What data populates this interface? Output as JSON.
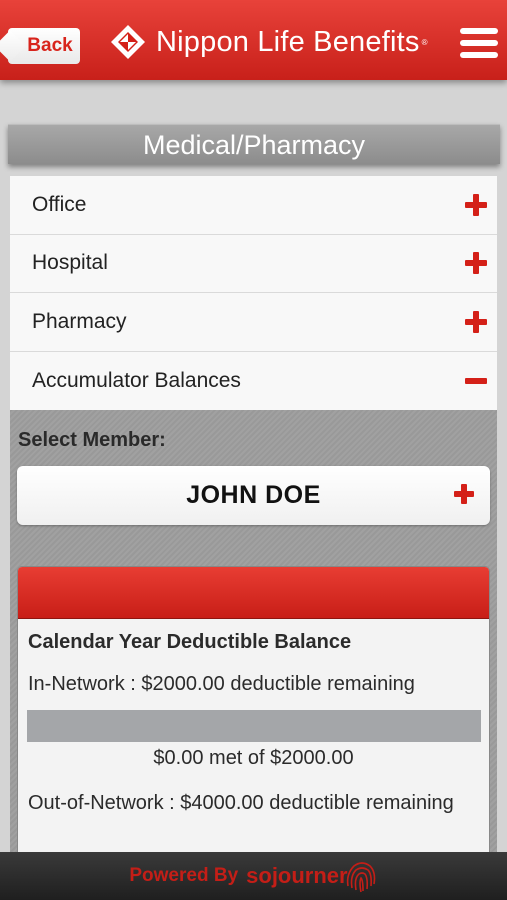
{
  "header": {
    "back_label": "Back",
    "brand_name": "Nippon Life Benefits",
    "brand_reg": "®",
    "logo_icon": "nippon-life-logo-icon",
    "menu_icon": "hamburger-menu-icon",
    "accent_color": "#d42018"
  },
  "section": {
    "title": "Medical/Pharmacy"
  },
  "accordion": {
    "items": [
      {
        "label": "Office",
        "icon": "plus-icon"
      },
      {
        "label": "Hospital",
        "icon": "plus-icon"
      },
      {
        "label": "Pharmacy",
        "icon": "plus-icon"
      },
      {
        "label": "Accumulator Balances",
        "icon": "minus-icon"
      }
    ]
  },
  "accumulator": {
    "select_label": "Select Member:",
    "member_name": "JOHN DOE",
    "card": {
      "title": "Calendar Year Deductible Balance",
      "in_network": "In-Network : $2000.00 deductible remaining",
      "progress_fraction": 0,
      "met_text": "$0.00 met of $2000.00",
      "out_network": "Out-of-Network : $4000.00 deductible remaining"
    }
  },
  "footer": {
    "powered_by": "Powered By",
    "brand": "sojourner",
    "brand_icon": "fingerprint-icon"
  }
}
